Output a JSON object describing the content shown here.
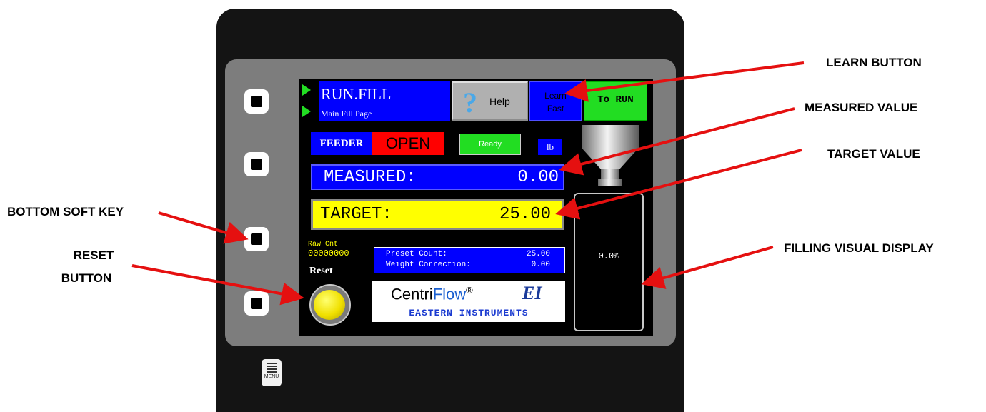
{
  "screen": {
    "title": "RUN.FILL",
    "subtitle": "Main Fill Page",
    "help_label": "Help",
    "learn_line1": "Learn",
    "learn_line2": "Fast",
    "to_run_label": "To RUN",
    "feeder_label": "FEEDER",
    "feeder_status": "OPEN",
    "ready_label": "Ready",
    "unit": "lb",
    "measured_label": "MEASURED:",
    "measured_value": "0.00",
    "target_label": "TARGET:",
    "target_value": "25.00",
    "raw_count_label": "Raw Cnt",
    "raw_count_value": "00000000",
    "reset_label": "Reset",
    "preset_count_label": "Preset Count:",
    "preset_count_value": "25.00",
    "weight_correction_label": "Weight Correction:",
    "weight_correction_value": "0.00",
    "logo_centri": "Centri",
    "logo_flow": "Flow",
    "logo_reg": "®",
    "logo_ei": "EI",
    "logo_company": "EASTERN INSTRUMENTS",
    "fill_percent_label": "0.0%",
    "fill_fraction": 0.0
  },
  "device": {
    "menu_label": "MENU"
  },
  "annotations": {
    "learn_button": "LEARN BUTTON",
    "measured_value": "MEASURED VALUE",
    "target_value": "TARGET VALUE",
    "bottom_soft_key": "BOTTOM SOFT KEY",
    "reset_line1": "RESET",
    "reset_line2": "BUTTON",
    "filling_visual_display": "FILLING VISUAL DISPLAY"
  },
  "colors": {
    "arrow": "#e51010",
    "screen_blue": "#0000ff",
    "target_yellow": "#ffff00",
    "status_red": "#ff0000",
    "status_green": "#22dd22"
  }
}
